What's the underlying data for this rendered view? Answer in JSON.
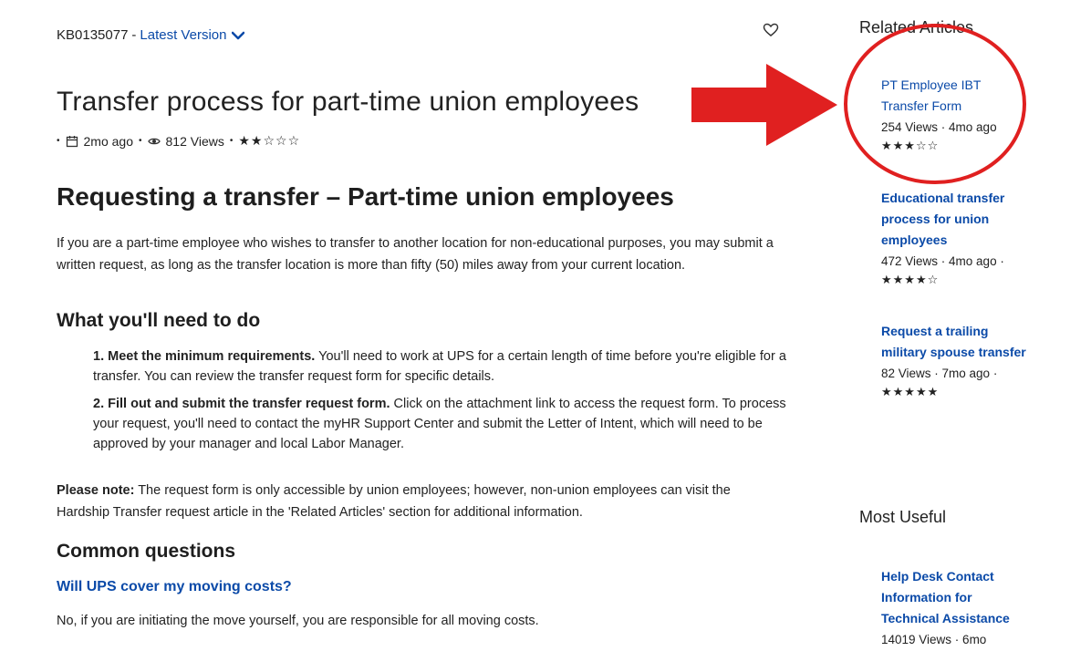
{
  "kb": {
    "id": "KB0135077",
    "separator": "-",
    "version_label": "Latest Version"
  },
  "article": {
    "title": "Transfer process for part-time union employees",
    "updated": "2mo ago",
    "views": "812 Views",
    "rating_stars": "★★☆☆☆",
    "section_title": "Requesting a transfer – Part-time union employees",
    "intro": "If you are a part-time employee who wishes to transfer to another location for non-educational purposes, you may submit a written request, as long as the transfer location is more than fifty (50) miles away from your current location.",
    "todo_heading": "What you'll need to do",
    "steps": [
      {
        "lead": "1. Meet the minimum requirements.",
        "text": " You'll need to work at UPS for a certain length of time before you're eligible for a transfer. You can review the transfer request form for specific details."
      },
      {
        "lead": "2. Fill out and submit the transfer request form.",
        "text": " Click on the attachment link to access the request form. To process your request, you'll need to contact the myHR Support Center and submit the Letter of Intent, which will need to be approved by your manager and local Labor Manager."
      }
    ],
    "note_label": "Please note:",
    "note_text": " The request form is only accessible by union employees; however, non-union employees can visit the Hardship Transfer request article in the 'Related Articles' section for additional information.",
    "common_heading": "Common questions",
    "question_1": "Will UPS cover my moving costs?",
    "answer_1": "No, if you are initiating the move yourself, you are responsible for all moving costs."
  },
  "sidebar": {
    "related_heading": "Related Articles",
    "related": [
      {
        "title": "PT Employee IBT Transfer Form",
        "meta": "254 Views  ·  4mo ago",
        "stars": "★★★☆☆"
      },
      {
        "title": "Educational transfer process for union employees",
        "meta": "472 Views  ·  4mo ago  ·",
        "stars": "★★★★☆"
      },
      {
        "title": "Request a trailing military spouse transfer",
        "meta": "82 Views  ·  7mo ago  ·",
        "stars": "★★★★★"
      }
    ],
    "useful_heading": "Most Useful",
    "useful": [
      {
        "title": "Help Desk Contact Information for Technical Assistance",
        "meta": "14019 Views  ·  6mo"
      }
    ]
  },
  "colors": {
    "link": "#0b4aa8",
    "annotation": "#e02020"
  },
  "icons": {
    "version_chevron": "chevron-down-icon",
    "favorite": "heart-icon",
    "calendar": "calendar-icon",
    "views": "eye-icon"
  }
}
